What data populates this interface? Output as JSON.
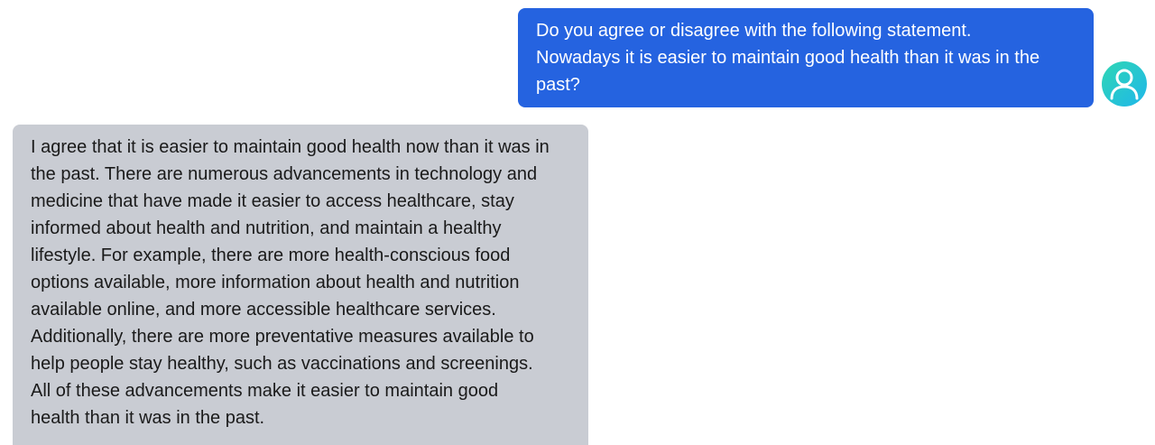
{
  "user_message": {
    "lines": [
      "Do you agree or disagree with the following statement.",
      "Nowadays it is easier to maintain good health than it was in the",
      "past?"
    ],
    "avatar_icon": "user-icon",
    "bubble_color": "#2563e0",
    "avatar_gradient": [
      "#2fd6b4",
      "#1fb7ea"
    ]
  },
  "assistant_message": {
    "lines": [
      "I agree that it is easier to maintain good health now than it was in",
      "the past. There are numerous advancements in technology and",
      "medicine that have made it easier to access healthcare, stay",
      "informed about health and nutrition, and maintain a healthy",
      "lifestyle. For example, there are more health-conscious food",
      "options available, more information about health and nutrition",
      "available online, and more accessible healthcare services.",
      "Additionally, there are more preventative measures available to",
      "help people stay healthy, such as vaccinations and screenings.",
      "All of these advancements make it easier to maintain good",
      "health than it was in the past."
    ],
    "bubble_color": "#c9ccd3"
  }
}
